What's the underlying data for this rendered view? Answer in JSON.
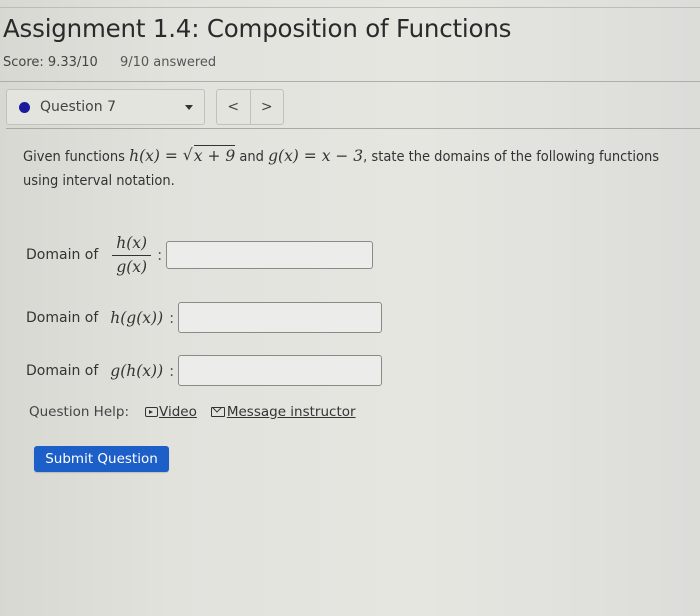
{
  "assignment": {
    "title": "Assignment 1.4: Composition of Functions",
    "score": "Score: 9.33/10",
    "answered": "9/10 answered"
  },
  "question_nav": {
    "selected": "Question 7",
    "status_color": "#1a1a9c",
    "prev_label": "<",
    "next_label": ">"
  },
  "question": {
    "prompt_intro": "Given functions ",
    "h_def_lhs": "h(x) = ",
    "h_def_radicand": "x + 9",
    "and": " and ",
    "g_def": "g(x) = x − 3",
    "prompt_rest": ", state the domains of the following functions",
    "prompt_line2": "using interval notation.",
    "parts": [
      {
        "label": "Domain of",
        "expr_num": "h(x)",
        "expr_den": "g(x)",
        "value": ""
      },
      {
        "label": "Domain of",
        "expr": "h(g(x))",
        "value": ""
      },
      {
        "label": "Domain of",
        "expr": "g(h(x))",
        "value": ""
      }
    ],
    "colon": ":"
  },
  "help": {
    "label": "Question Help:",
    "video_label": "Video",
    "message_label": "Message instructor"
  },
  "submit_label": "Submit Question",
  "colors": {
    "submit_button": "#1d5fc8"
  }
}
